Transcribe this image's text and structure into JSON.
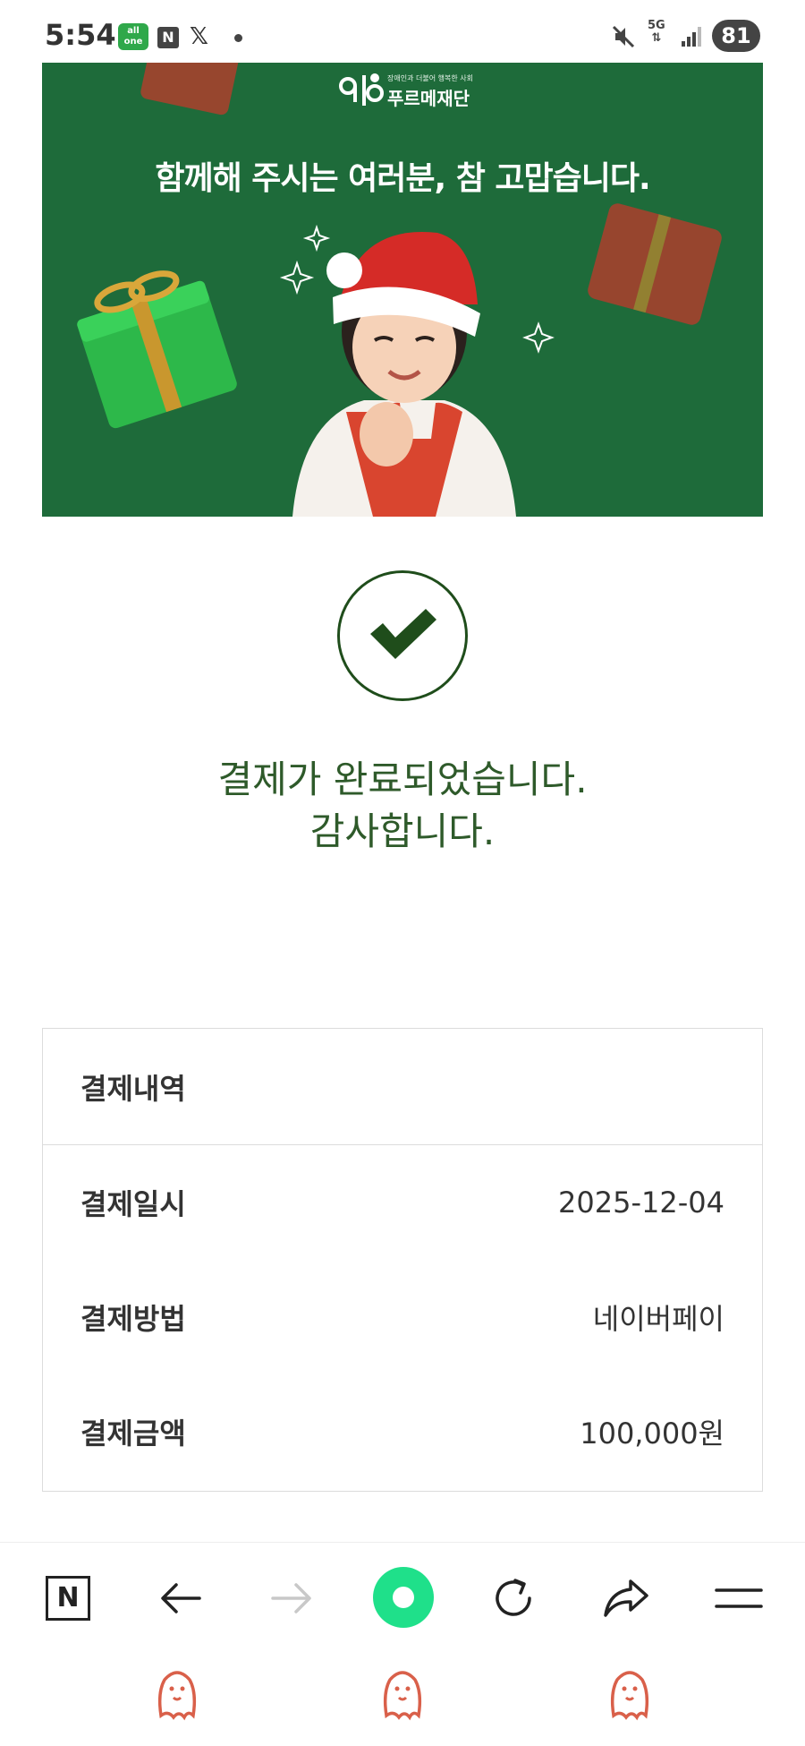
{
  "status_bar": {
    "time": "5:54",
    "app_badge": "all one",
    "n_badge": "N",
    "x_glyph": "𝕏",
    "network": "5G",
    "battery": "81"
  },
  "banner": {
    "logo_tagline": "장애인과 더불어 행복한 사회",
    "logo_name": "푸르메재단",
    "headline": "함께해 주시는 여러분, 참 고맙습니다."
  },
  "confirmation": {
    "line1": "결제가 완료되었습니다.",
    "line2": "감사합니다."
  },
  "payment": {
    "header": "결제내역",
    "rows": [
      {
        "label": "결제일시",
        "value": "2025-12-04"
      },
      {
        "label": "결제방법",
        "value": "네이버페이"
      },
      {
        "label": "결제금액",
        "value": "100,000원"
      }
    ]
  },
  "toolbar": {
    "n_label": "N"
  },
  "colors": {
    "banner_bg": "#1e6b3a",
    "check_green": "#1f4d1b",
    "message_green": "#2e5a2a",
    "home_button": "#1fe08a",
    "ghost": "#d9604a"
  },
  "icons": [
    "n-icon",
    "back-arrow-icon",
    "forward-arrow-icon",
    "home-circle-icon",
    "reload-icon",
    "share-icon",
    "menu-icon",
    "ghost-icon"
  ]
}
